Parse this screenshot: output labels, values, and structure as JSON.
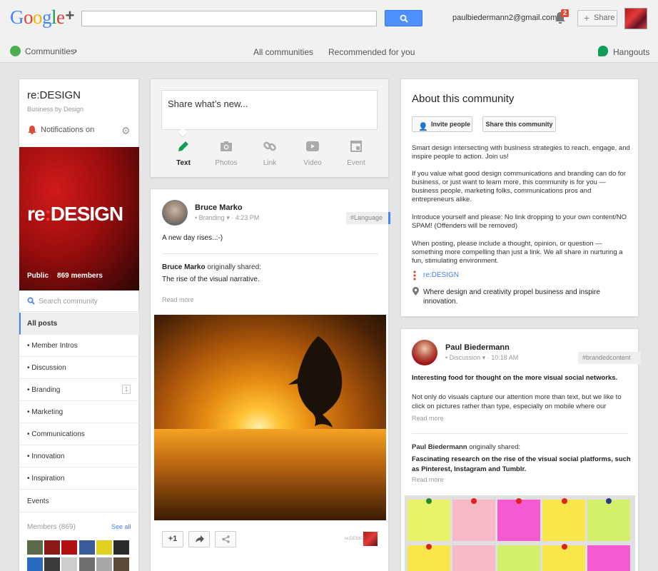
{
  "header": {
    "logo_letters": [
      "G",
      "o",
      "o",
      "g",
      "l",
      "e"
    ],
    "logo_plus": "+",
    "search_placeholder": "",
    "account_email": "paulbiedermann2@gmail.com",
    "notification_count": "2",
    "share_label": "Share",
    "plus_sign": "+"
  },
  "subnav": {
    "communities": "Communities",
    "chevron": "›",
    "all_communities": "All communities",
    "recommended": "Recommended for you",
    "hangouts": "Hangouts"
  },
  "community": {
    "name": "re:DESIGN",
    "tagline": "Business by Design",
    "notifications": "Notifications on",
    "cover_logo_left": "re",
    "cover_logo_colon": ":",
    "cover_logo_right": "DESIGN",
    "visibility": "Public",
    "members_count": "869 members",
    "search_placeholder": "Search community",
    "categories": [
      {
        "label": "All posts",
        "active": true
      },
      {
        "label": "• Member Intros"
      },
      {
        "label": "• Discussion"
      },
      {
        "label": "• Branding",
        "count": "1"
      },
      {
        "label": "• Marketing"
      },
      {
        "label": "• Communications"
      },
      {
        "label": "• Innovation"
      },
      {
        "label": "• Inspiration"
      },
      {
        "label": "Events"
      }
    ],
    "members_label": "Members (869)",
    "see_all": "See all"
  },
  "share_box": {
    "prompt": "Share what’s new...",
    "options": [
      "Text",
      "Photos",
      "Link",
      "Video",
      "Event"
    ]
  },
  "post1": {
    "author": "Bruce Marko",
    "category": "Branding",
    "time": "4:23 PM",
    "tag": "#Language",
    "text": "A new day rises..:-)",
    "orig_author": "Bruce Marko",
    "orig_suffix": " originally shared:",
    "orig_title": "The rise of the visual narrative.",
    "read_more": "Read more",
    "plus_one": "+1",
    "mini_logo": "re:DESIGN"
  },
  "about": {
    "title": "About this community",
    "invite": "Invite people",
    "share_community": "Share this community",
    "paragraphs": [
      "Smart design intersecting with business strategies to reach, engage, and inspire people to action. Join us!",
      "If you value what good design communications and branding can do for business, or just want to learn more, this community is for you — business people, marketing folks, communications pros and entrepreneurs alike.",
      "Introduce yourself and please: No link dropping to your own content/NO SPAM! (Offenders will be removed)",
      "When posting, please include a thought, opinion, or question — something more compelling than just a link. We all share in nurturing a fun, stimulating environment."
    ],
    "link": "re:DESIGN",
    "location": "Where design and creativity propel business and inspire innovation."
  },
  "post2": {
    "author": "Paul Biedermann",
    "category": "Discussion",
    "time": "10:18 AM",
    "tag": "#brandedcontent",
    "bold_text": "Interesting food for thought on the more visual social networks.",
    "text": "Not only do visuals capture our attention more than text, but we like to click on pictures rather than type, especially on mobile where our",
    "read_more": "Read more",
    "orig_author": "Paul Biedermann",
    "orig_suffix": " originally shared:",
    "orig_title": "Fascinating research on the rise of the visual social platforms, such as Pinterest, Instagram and Tumblr."
  },
  "colors": {
    "accent_blue": "#4285f4",
    "search_button": "#4d90fe",
    "notification_red": "#dd4b39",
    "link_blue": "#427fed"
  },
  "icons": [
    "search-icon",
    "bell-icon",
    "plus-icon",
    "communities-icon",
    "hangouts-icon",
    "gear-icon",
    "pencil-icon",
    "camera-icon",
    "link-icon",
    "video-icon",
    "event-icon",
    "share-arrow-icon",
    "location-icon"
  ]
}
